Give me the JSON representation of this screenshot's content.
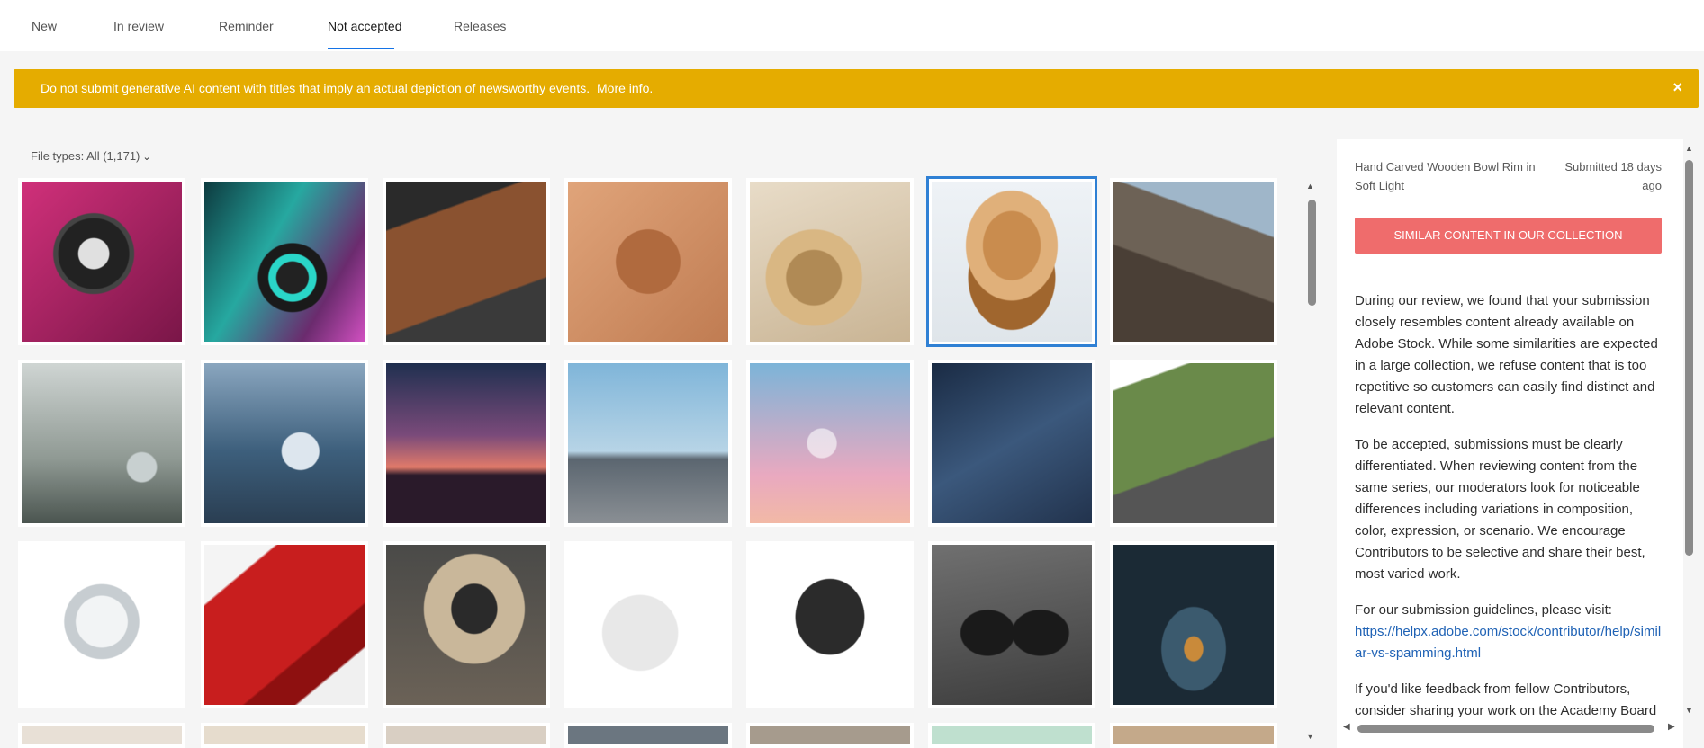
{
  "tabs": [
    {
      "label": "New"
    },
    {
      "label": "In review"
    },
    {
      "label": "Reminder"
    },
    {
      "label": "Not accepted",
      "active": true
    },
    {
      "label": "Releases"
    }
  ],
  "banner": {
    "text": "Do not submit generative AI content with titles that imply an actual depiction of newsworthy events.",
    "link": "More info.",
    "close_icon": "close-icon"
  },
  "filter": {
    "label": "File types: All (1,171)"
  },
  "thumbnails": [
    {
      "subject": "flashlight-on-pink"
    },
    {
      "subject": "led-strip-reel"
    },
    {
      "subject": "leather-wallet"
    },
    {
      "subject": "embossed-maple-leaf"
    },
    {
      "subject": "rope-coil"
    },
    {
      "subject": "wooden-bowl",
      "selected": true
    },
    {
      "subject": "granite-ledge"
    },
    {
      "subject": "misty-crystal-ball"
    },
    {
      "subject": "glass-sphere-water"
    },
    {
      "subject": "balloon-sunset"
    },
    {
      "subject": "glass-cube"
    },
    {
      "subject": "soap-bubble-sky"
    },
    {
      "subject": "jeans-pocket"
    },
    {
      "subject": "parrot-on-monitor"
    },
    {
      "subject": "crystal-ball-white"
    },
    {
      "subject": "red-rubber-sheet"
    },
    {
      "subject": "retro-computer"
    },
    {
      "subject": "cotton-pads"
    },
    {
      "subject": "vr-controller"
    },
    {
      "subject": "sunglasses"
    },
    {
      "subject": "water-drop"
    }
  ],
  "panel": {
    "title": "Hand Carved Wooden Bowl Rim in Soft Light",
    "submitted": "Submitted 18 days ago",
    "status_button": "SIMILAR CONTENT IN OUR COLLECTION",
    "paragraphs": [
      "During our review, we found that your submission closely resembles content already available on Adobe Stock. While some similarities are expected in a large collection, we refuse content that is too repetitive so customers can easily find distinct and relevant content.",
      "To be accepted, submissions must be clearly differentiated. When reviewing content from the same series, our moderators look for noticeable differences including variations in composition, color, expression, or scenario. We encourage Contributors to be selective and share their best, most varied work.",
      "For our submission guidelines, please visit:"
    ],
    "guideline_link": "https://helpx.adobe.com/stock/contributor/help/similar-vs-spamming.html",
    "paragraph_last": "If you'd like feedback from fellow Contributors, consider sharing your work on the Academy Board"
  },
  "colors": {
    "accent": "#1473e6",
    "banner": "#e5ac00",
    "status_button": "#ef6c6c",
    "selected_outline": "#2f80d4"
  }
}
